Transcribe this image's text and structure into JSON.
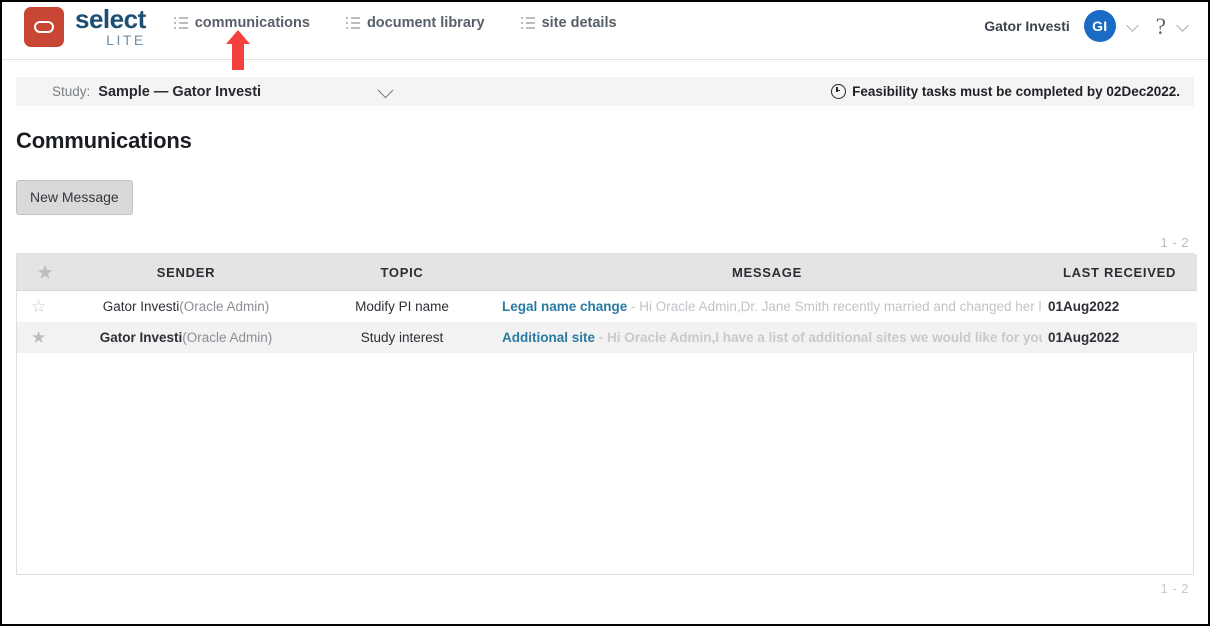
{
  "header": {
    "logo": {
      "brand": "select",
      "sub": "LITE",
      "icon": "oracle-oval-icon",
      "color": "#c74634"
    },
    "nav": [
      {
        "label": "communications",
        "icon": "list-icon",
        "active": true
      },
      {
        "label": "document library",
        "icon": "list-icon",
        "active": false
      },
      {
        "label": "site details",
        "icon": "list-icon",
        "active": false
      }
    ],
    "user": {
      "name": "Gator Investi",
      "avatar_initials": "GI",
      "avatar_color": "#1a6bc4"
    },
    "help_glyph": "?"
  },
  "study_bar": {
    "label": "Study:",
    "value": "Sample — Gator Investi",
    "notice": "Feasibility tasks must be completed by 02Dec2022.",
    "notice_icon": "clock-icon"
  },
  "page": {
    "title": "Communications",
    "new_message_label": "New Message"
  },
  "table": {
    "pager_top": "1 - 2",
    "pager_bottom": "1 - 2",
    "headers": {
      "star": "★",
      "sender": "SENDER",
      "topic": "TOPIC",
      "message": "MESSAGE",
      "last_received": "LAST RECEIVED"
    },
    "rows": [
      {
        "starred": false,
        "star_glyph": "☆",
        "sender_name": "Gator Investi",
        "sender_role": "(Oracle Admin)",
        "topic": "Modify PI name",
        "subject": "Legal name change",
        "preview": " - Hi Oracle Admin,Dr. Jane Smith recently married and changed her legal name to Ja",
        "last_received": "01Aug2022",
        "unread": false
      },
      {
        "starred": true,
        "star_glyph": "★",
        "sender_name": "Gator Investi",
        "sender_role": "(Oracle Admin)",
        "topic": "Study interest",
        "subject": "Additional site",
        "preview": " - Hi Oracle Admin,I have a list of additional sites we would like for you to consider fo",
        "last_received": "01Aug2022",
        "unread": true
      }
    ]
  },
  "annotation": {
    "arrow": "red-up-arrow",
    "color": "#f4413d"
  }
}
